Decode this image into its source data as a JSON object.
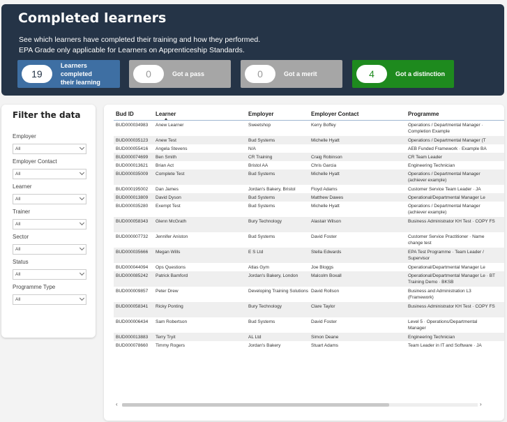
{
  "header": {
    "title": "Completed learners",
    "subtitle_line1": "See which learners have completed their training and how they performed.",
    "subtitle_line2": "EPA Grade only applicable for Learners on Apprenticeship Standards."
  },
  "kpis": {
    "completed": {
      "value": "19",
      "label_line1": "Learners completed",
      "label_line2": "their learning",
      "color": "#3e6fa3"
    },
    "pass": {
      "value": "0",
      "label": "Got a pass",
      "color": "#a6a6a6"
    },
    "merit": {
      "value": "0",
      "label": "Got a merit",
      "color": "#a6a6a6"
    },
    "distinction": {
      "value": "4",
      "label": "Got a distinction",
      "color": "#1e8a1e"
    }
  },
  "filters": {
    "title": "Filter the data",
    "items": [
      {
        "label": "Employer",
        "value": "All"
      },
      {
        "label": "Employer Contact",
        "value": "All"
      },
      {
        "label": "Learner",
        "value": "All"
      },
      {
        "label": "Trainer",
        "value": "All"
      },
      {
        "label": "Sector",
        "value": "All"
      },
      {
        "label": "Status",
        "value": "All"
      },
      {
        "label": "Programme Type",
        "value": "All"
      }
    ]
  },
  "table": {
    "columns": [
      "Bud ID",
      "Learner",
      "Employer",
      "Employer Contact",
      "Programme"
    ],
    "rows": [
      [
        "BUD000034983",
        "Anew Learner",
        "Sweetshop",
        "Kerry Boffey",
        "Operations / Departmental Manager · Completion Example"
      ],
      [
        "BUD000035123",
        "Anew Test",
        "Bud Systems",
        "Michelle Hyatt",
        "Operations / Departmental Manager (T"
      ],
      [
        "BUD000055416",
        "Angela Stevens",
        "N/A",
        "",
        "AEB Funded Framework · Example BA"
      ],
      [
        "BUD000074699",
        "Ben Smith",
        "CR Training",
        "Craig Robinson",
        "CR Team Leader"
      ],
      [
        "BUD000013621",
        "Brian Act",
        "Bristol AA",
        "Chris Garcia",
        "Engineering Technician"
      ],
      [
        "BUD000035009",
        "Complete Test",
        "Bud Systems",
        "Michelle Hyatt",
        "Operations / Departmental Manager (achiever example)"
      ],
      [
        "BUD000195002",
        "Dan James",
        "Jordan's Bakery, Bristol",
        "Floyd Adams",
        "Customer Service Team Leader · JA"
      ],
      [
        "BUD000013809",
        "David Dyson",
        "Bud Systems",
        "Matthew Dawes",
        "Operational/Departmental Manager Le"
      ],
      [
        "BUD000035280",
        "Exempt Test",
        "Bud Systems",
        "Michelle Hyatt",
        "Operations / Departmental Manager (achiever example)"
      ],
      [
        "BUD000058343",
        "Glenn McGrath",
        "Bury Technology",
        "Alastair Wilson",
        "Business Administrator KH Test · COPY FS"
      ],
      [
        "BUD000007732",
        "Jennifer Aniston",
        "Bud Systems",
        "David Foster",
        "Customer Service Practitioner · Name change test"
      ],
      [
        "BUD000035666",
        "Megan Wills",
        "E S Ltd",
        "Stella Edwards",
        "EPA Test Programme · Team Leader / Supervisor"
      ],
      [
        "BUD000044094",
        "Ops Questions",
        "Atlas Gym",
        "Joe Bloggs",
        "Operational/Departmental Manager Le"
      ],
      [
        "BUD000085242",
        "Patrick Bamford",
        "Jordan's Bakery, London",
        "Malcolm Boxall",
        "Operational/Departmental Manager Le · BT Training Demo · BKSB"
      ],
      [
        "BUD000009857",
        "Peter Drew",
        "Developing Training Solutions",
        "David Rollson",
        "Business and Administration L3 (Framework)"
      ],
      [
        "BUD000058341",
        "Ricky Ponting",
        "Bury Technology",
        "Clare Taylor",
        "Business Administrator KH Test · COPY FS"
      ],
      [
        "BUD000006434",
        "Sam Robertson",
        "Bud Systems",
        "David Foster",
        "Level 5 · Operations/Departmental Manager"
      ],
      [
        "BUD000013883",
        "Terry Tryit",
        "AL Ltd",
        "Simon Deane",
        "Engineering Technician"
      ],
      [
        "BUD000078660",
        "Timmy Rogers",
        "Jordan's Bakery",
        "Stuart Adams",
        "Team Leader in IT and Software · JA"
      ]
    ]
  }
}
